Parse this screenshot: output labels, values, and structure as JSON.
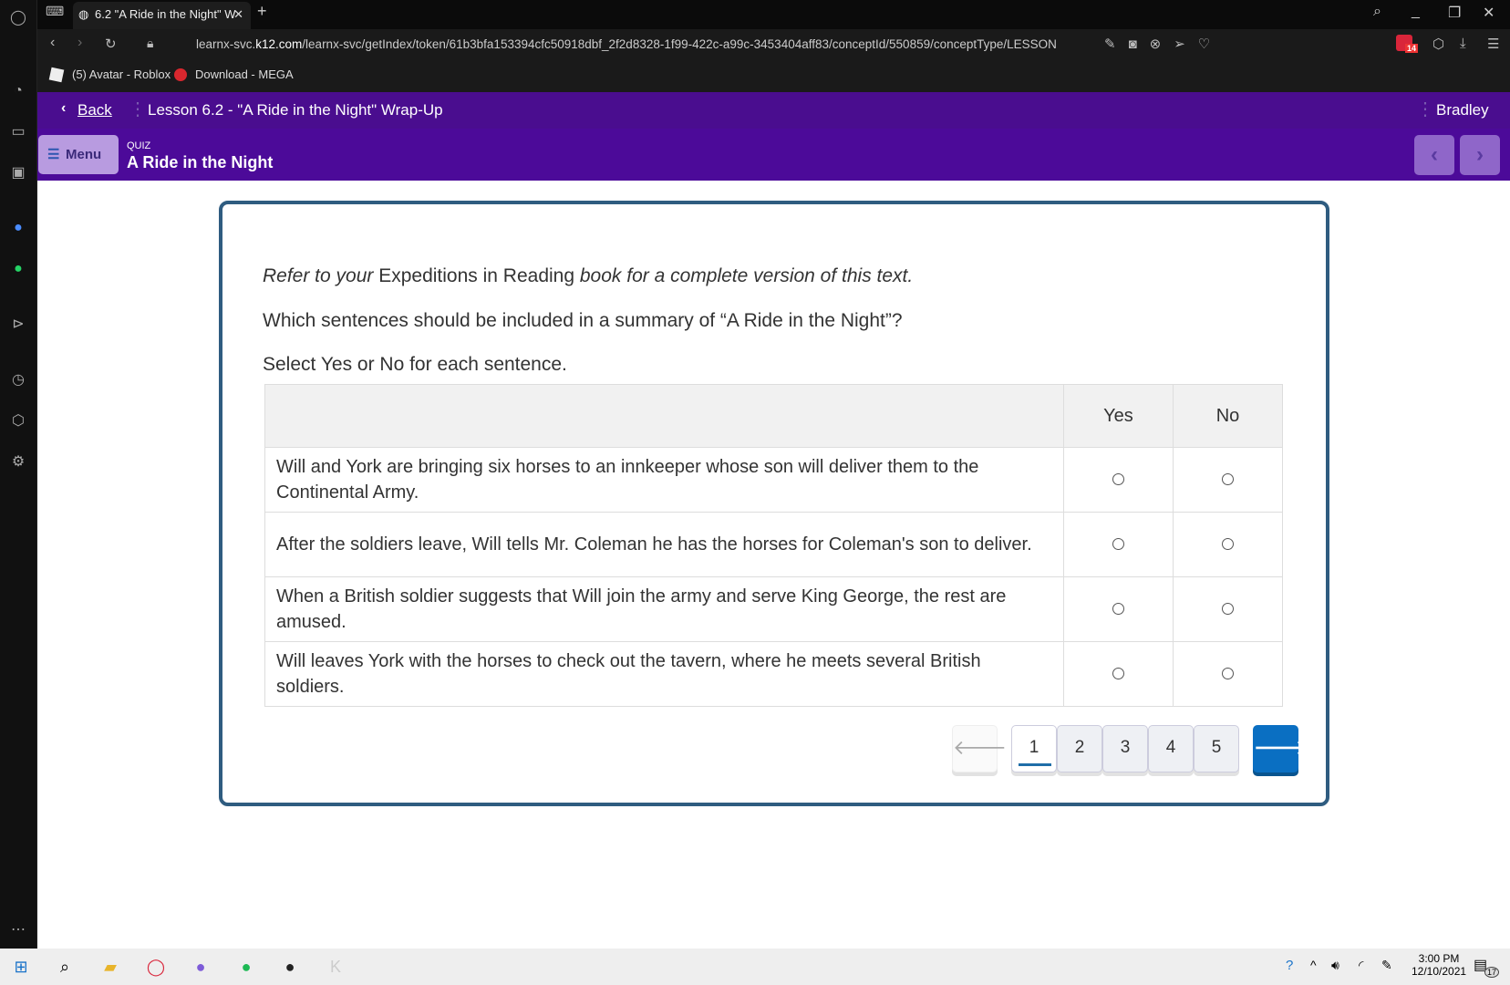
{
  "browser": {
    "tab_title": "6.2 \"A Ride in the Night\" W",
    "url_prefix": "learnx-svc.",
    "url_domain": "k12.com",
    "url_rest": "/learnx-svc/getIndex/token/61b3bfa153394cfc50918dbf_2f2d8328-1f99-422c-a99c-3453404aff83/conceptId/550859/conceptType/LESSON",
    "bookmarks": [
      {
        "label": "(5) Avatar - Roblox"
      },
      {
        "label": "Download - MEGA"
      }
    ],
    "extension_badge": "14"
  },
  "header": {
    "back": "Back",
    "lesson_title": "Lesson 6.2 - \"A Ride in the Night\" Wrap-Up",
    "user": "Bradley"
  },
  "quizbar": {
    "menu": "Menu",
    "kind": "QUIZ",
    "title": "A Ride in the Night"
  },
  "question": {
    "ref_italic1": "Refer to your",
    "ref_book": " Expeditions in Reading ",
    "ref_italic2": "book for a complete version of this text.",
    "prompt": "Which sentences should be included in a summary of “A Ride in the Night”?",
    "instruction": "Select Yes or No for each sentence.",
    "columns": [
      "Yes",
      "No"
    ],
    "rows": [
      {
        "text": "Will and York are bringing six horses to an innkeeper whose son will deliver them to the Continental Army."
      },
      {
        "text": "After the soldiers leave, Will tells Mr. Coleman he has the horses for Coleman's son to deliver."
      },
      {
        "text": "When a British soldier suggests that Will join the army and serve King George, the rest are amused."
      },
      {
        "text": "Will leaves York with the horses to check out the tavern, where he meets several British soldiers."
      }
    ]
  },
  "pagination": {
    "pages": [
      "1",
      "2",
      "3",
      "4",
      "5"
    ],
    "current": "1"
  },
  "taskbar": {
    "time": "3:00 PM",
    "date": "12/10/2021",
    "notifications": "17"
  },
  "colors": {
    "header": "#4a0d8f",
    "card_border": "#2f5c80",
    "next": "#0a6fc2"
  }
}
